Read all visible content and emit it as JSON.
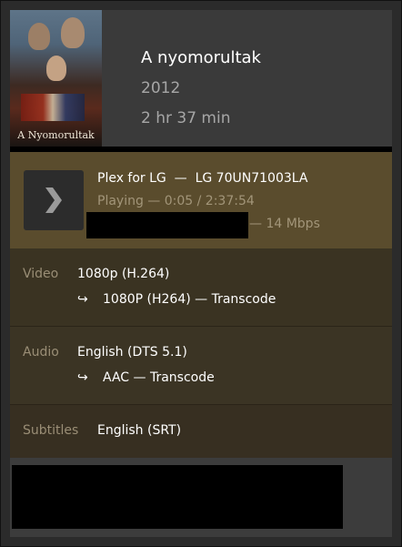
{
  "media": {
    "poster_title": "A Nyomorultak",
    "title": "A nyomorultak",
    "year": "2012",
    "duration": "2 hr 37 min"
  },
  "player": {
    "name": "Plex for LG  —  LG 70UN71003LA",
    "status": "Playing — 0:05 / 2:37:54",
    "bitrate": "— 14 Mbps"
  },
  "streams": {
    "video": {
      "label": "Video",
      "source": "1080p (H.264)",
      "arrow": "↪",
      "target": "1080P (H264) — Transcode"
    },
    "audio": {
      "label": "Audio",
      "source": "English (DTS 5.1)",
      "arrow": "↪",
      "target": "AAC — Transcode"
    },
    "subtitles": {
      "label": "Subtitles",
      "source": "English (SRT)"
    }
  },
  "colors": {
    "player_bg": "#5a4c2d",
    "stream_bg": "#3a3322",
    "muted_text": "#a29579"
  }
}
